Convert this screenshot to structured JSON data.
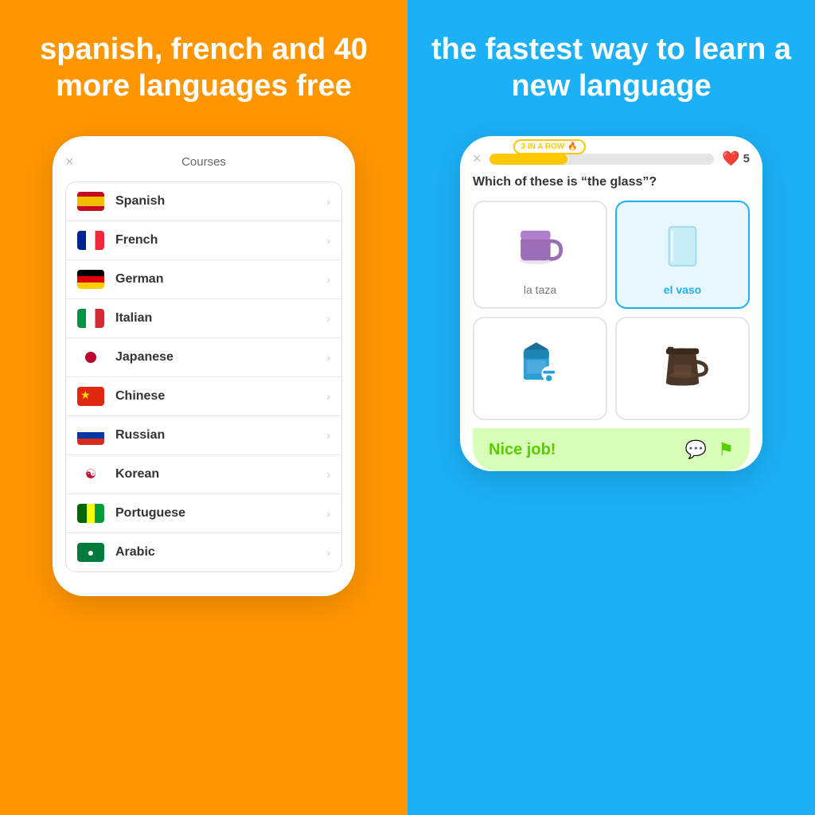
{
  "left": {
    "headline": "spanish, french and 40 more languages free",
    "phone": {
      "close_icon": "×",
      "header_title": "Courses",
      "courses": [
        {
          "name": "Spanish",
          "flag": "spanish"
        },
        {
          "name": "French",
          "flag": "french"
        },
        {
          "name": "German",
          "flag": "german"
        },
        {
          "name": "Italian",
          "flag": "italian"
        },
        {
          "name": "Japanese",
          "flag": "japanese"
        },
        {
          "name": "Chinese",
          "flag": "chinese"
        },
        {
          "name": "Russian",
          "flag": "russian"
        },
        {
          "name": "Korean",
          "flag": "korean"
        },
        {
          "name": "Portuguese",
          "flag": "portuguese"
        },
        {
          "name": "Arabic",
          "flag": "arabic"
        }
      ]
    }
  },
  "right": {
    "headline": "the fastest way to learn a new language",
    "phone": {
      "close_icon": "×",
      "streak_label": "3 IN A ROW",
      "progress": 35,
      "hearts": 5,
      "question": "Which of these is “the glass”?",
      "answers": [
        {
          "label": "la taza",
          "selected": false
        },
        {
          "label": "el vaso",
          "selected": true
        },
        {
          "label": "",
          "selected": false
        },
        {
          "label": "",
          "selected": false
        }
      ],
      "nice_job_text": "Nice job!",
      "chat_icon": "💬",
      "flag_icon": "⚑"
    }
  }
}
